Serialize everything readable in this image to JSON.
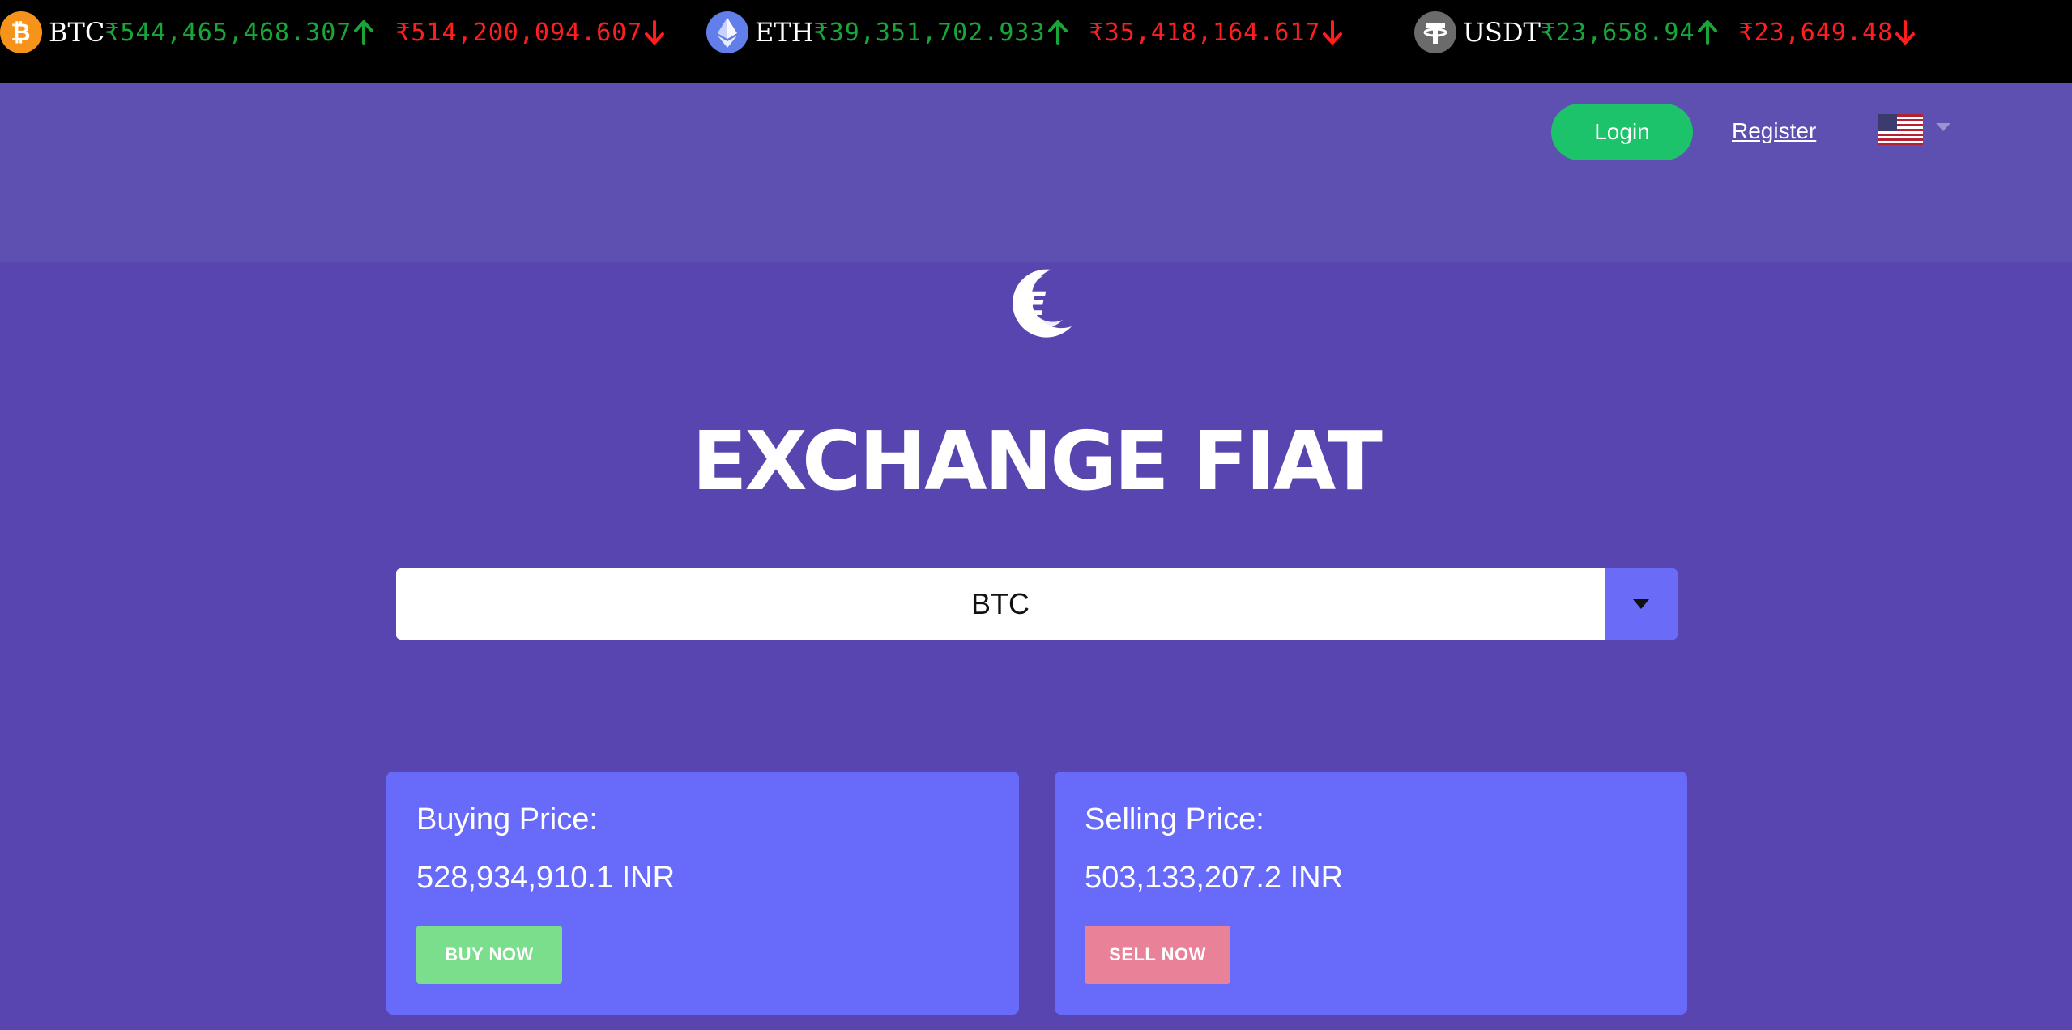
{
  "ticker": [
    {
      "symbol": "BTC",
      "icon": "bitcoin-icon",
      "high": "₹544,465,468.307",
      "low": "₹514,200,094.607",
      "color": "#f7931a"
    },
    {
      "symbol": "ETH",
      "icon": "ethereum-icon",
      "high": "₹39,351,702.933",
      "low": "₹35,418,164.617",
      "color": "#627eea"
    },
    {
      "symbol": "USDT",
      "icon": "tether-icon",
      "high": "₹23,658.94",
      "low": "₹23,649.48",
      "color": "#6b6b6b"
    }
  ],
  "header": {
    "login_label": "Login",
    "register_label": "Register",
    "language_icon": "us-flag-icon"
  },
  "main": {
    "title": "EXCHANGE FIAT",
    "selected_coin": "BTC",
    "buy": {
      "label": "Buying Price:",
      "price": "528,934,910.1 INR",
      "button": "BUY NOW"
    },
    "sell": {
      "label": "Selling Price:",
      "price": "503,133,207.2 INR",
      "button": "SELL NOW"
    }
  },
  "colors": {
    "up": "#17a637",
    "down": "#ff1e1e",
    "login": "#1dc36a",
    "card": "#686af9",
    "buy_button": "#7bde8c",
    "sell_button": "#e98298"
  }
}
